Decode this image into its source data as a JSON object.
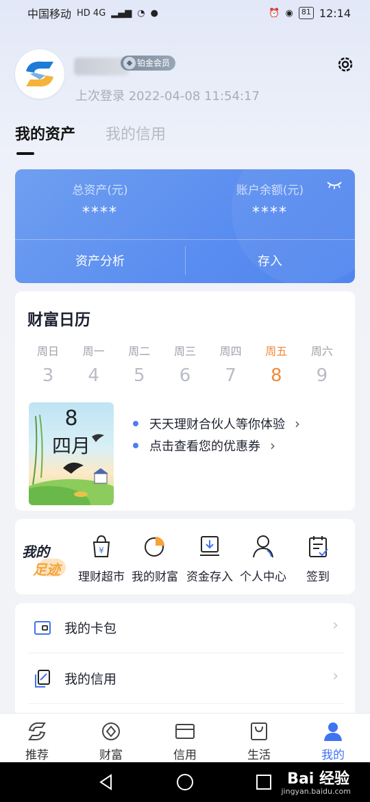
{
  "status_bar": {
    "carrier": "中国移动",
    "network": "HD 4G",
    "battery": "81",
    "time": "12:14"
  },
  "profile": {
    "member_badge": "铂金会员",
    "last_login": "上次登录 2022-04-08 11:54:17"
  },
  "tabs": [
    {
      "label": "我的资产",
      "active": true
    },
    {
      "label": "我的信用",
      "active": false
    }
  ],
  "asset_card": {
    "total_label": "总资产(元)",
    "total_value": "****",
    "balance_label": "账户余额(元)",
    "balance_value": "****",
    "analysis_button": "资产分析",
    "deposit_button": "存入"
  },
  "wealth_calendar": {
    "title": "财富日历",
    "days": [
      {
        "weekday": "周日",
        "date": "3"
      },
      {
        "weekday": "周一",
        "date": "4"
      },
      {
        "weekday": "周二",
        "date": "5"
      },
      {
        "weekday": "周三",
        "date": "6"
      },
      {
        "weekday": "周四",
        "date": "7"
      },
      {
        "weekday": "周五",
        "date": "8"
      },
      {
        "weekday": "周六",
        "date": "9"
      }
    ],
    "today_index": 5,
    "image_day": "8",
    "image_month": "四月",
    "links": [
      "天天理财合伙人等你体验",
      "点击查看您的优惠券"
    ]
  },
  "footprint": {
    "logo_line1": "我的",
    "logo_line2": "足迹",
    "items": [
      {
        "label": "理财超市",
        "icon": "shopping-bag-icon"
      },
      {
        "label": "我的财富",
        "icon": "pie-chart-icon"
      },
      {
        "label": "资金存入",
        "icon": "deposit-icon"
      },
      {
        "label": "个人中心",
        "icon": "person-icon"
      },
      {
        "label": "签到",
        "icon": "checkin-icon"
      }
    ]
  },
  "menu": [
    {
      "label": "我的卡包",
      "icon": "wallet-icon"
    },
    {
      "label": "我的信用",
      "icon": "credit-icon"
    }
  ],
  "bottom_nav": [
    {
      "label": "推荐",
      "icon": "home-logo-icon"
    },
    {
      "label": "财富",
      "icon": "wealth-icon"
    },
    {
      "label": "信用",
      "icon": "card-icon"
    },
    {
      "label": "生活",
      "icon": "bag-icon"
    },
    {
      "label": "我的",
      "icon": "user-icon",
      "active": true
    }
  ],
  "watermark": {
    "text": "Bai 经验",
    "sub": "jingyan.baidu.com"
  },
  "colors": {
    "accent_blue": "#4f85ee",
    "today_orange": "#f08a3c",
    "nav_active": "#3f73f0"
  }
}
